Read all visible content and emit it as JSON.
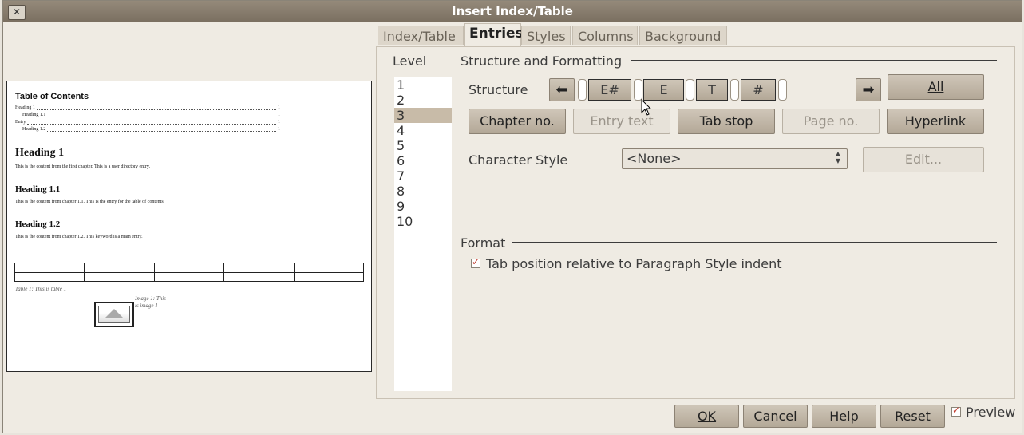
{
  "window": {
    "title": "Insert Index/Table"
  },
  "tabs": [
    {
      "label": "Index/Table",
      "active": false
    },
    {
      "label": "Entries",
      "active": true
    },
    {
      "label": "Styles",
      "active": false
    },
    {
      "label": "Columns",
      "active": false
    },
    {
      "label": "Background",
      "active": false
    }
  ],
  "preview_doc": {
    "toc_title": "Table of Contents",
    "toc_entries": [
      {
        "text": "Heading 1",
        "page": "1"
      },
      {
        "text": "Heading 1.1",
        "page": "1"
      },
      {
        "text": "Entry",
        "page": "1"
      },
      {
        "text": "Heading 1.2",
        "page": "1"
      }
    ],
    "h1": "Heading 1",
    "p1": "This is the content from the first chapter. This is a user directory entry.",
    "h11": "Heading 1.1",
    "p11": "This is the content from chapter 1.1. This is the entry for the table of contents.",
    "h12": "Heading 1.2",
    "p12": "This is the content from chapter 1.2. This keyword is a main entry.",
    "table_caption": "Table 1: This is table 1",
    "image_caption": "Image 1: This is image 1"
  },
  "level": {
    "label": "Level",
    "items": [
      "1",
      "2",
      "3",
      "4",
      "5",
      "6",
      "7",
      "8",
      "9",
      "10"
    ],
    "selected": "3"
  },
  "structure": {
    "section_title": "Structure and Formatting",
    "label": "Structure",
    "chips": [
      "E#",
      "E",
      "T",
      "#"
    ],
    "all_button": "All",
    "buttons": {
      "chapter_no": "Chapter no.",
      "entry_text": "Entry text",
      "tab_stop": "Tab stop",
      "page_no": "Page no.",
      "hyperlink": "Hyperlink"
    },
    "char_style_label": "Character Style",
    "char_style_value": "<None>",
    "edit_button": "Edit..."
  },
  "format": {
    "section_title": "Format",
    "tab_position_label": "Tab position relative to Paragraph Style indent",
    "tab_position_checked": true
  },
  "footer": {
    "ok": "OK",
    "cancel": "Cancel",
    "help": "Help",
    "reset": "Reset",
    "preview_label": "Preview",
    "preview_checked": true
  }
}
